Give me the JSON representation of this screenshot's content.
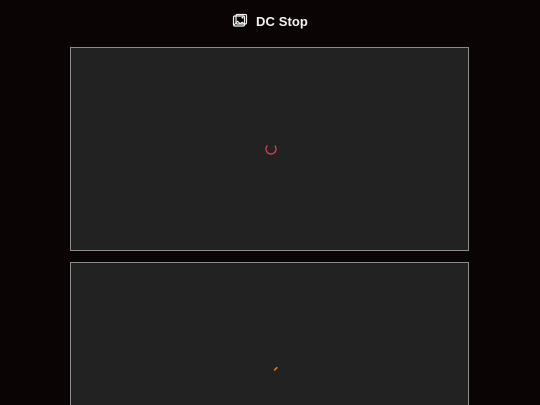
{
  "header": {
    "title": "DC Stop",
    "icon": "image-icon"
  },
  "panels": [
    {
      "state": "loading",
      "spinner_color": "#c8414d"
    },
    {
      "state": "loading",
      "spinner_color": "#e57a1f"
    }
  ],
  "colors": {
    "background": "#0a0404",
    "panel": "#222222",
    "panel_border": "#8b8b8b",
    "title": "#f2f2f2"
  }
}
